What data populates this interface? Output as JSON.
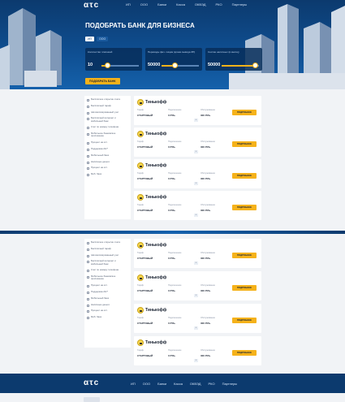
{
  "header": {
    "logo": "ατc",
    "nav": [
      "ИП",
      "ООО",
      "Банки",
      "Касса",
      "ОКВЭД",
      "РКО",
      "Партнеры"
    ]
  },
  "hero": {
    "title": "ПОДОБРАТЬ БАНК ДЛЯ БИЗНЕСА",
    "toggle": [
      "ИП",
      "ООО"
    ],
    "sliders": [
      {
        "label": "Количество платежей",
        "value": "10",
        "fraction": 0.15,
        "tip": "10"
      },
      {
        "label": "Переводы физ. лицам (кроме вывода ЗП)",
        "value": "50000",
        "fraction": 0.35,
        "tip": "50"
      },
      {
        "label": "Снятие наличных (в месяц)",
        "value": "50000",
        "fraction": 0.9,
        "tip": "50"
      }
    ],
    "button": "ПОДОБРАТЬ БАНК"
  },
  "filters": [
    "Бесплатное открытие счета",
    "Бесплатный тариф",
    "Автоматизированный учет",
    "Бесплатный интернет и мобильный банк",
    "Счет по номеру телефона",
    "Бесплатное обслуживание",
    "Процент на остаток",
    "Кэшбэк",
    "Выдача карт",
    "Процент на остаток",
    "Овердрафт",
    "Эквайринг",
    "Лимит снятия",
    "Бесплатное обслуживание"
  ],
  "filters_short": [
    "Бесплатное открытие счета",
    "Бесплатный тариф",
    "Автоматизированный учет",
    "Бесплатный интернет и мобильный банк",
    "Счет по номеру телефона",
    "Мобильное банковское приложение",
    "Процент на ост.",
    "Поддержка 24/7",
    "Мобильный банк",
    "Наличные деньги",
    "Процент на ост.",
    "Моб. банк"
  ],
  "card_labels": {
    "tariff": "Тариф",
    "payments": "Подключение",
    "service": "Обслуживание",
    "button": "ПОДРОБНЕЕ"
  },
  "cards": [
    {
      "bank": "Тинькофф",
      "tariff": "СТАРТОВЫЙ",
      "payments": "0 РУБ.",
      "service": "300 РУБ."
    },
    {
      "bank": "Тинькофф",
      "tariff": "СТАРТОВЫЙ",
      "payments": "0 РУБ.",
      "service": "300 РУБ."
    },
    {
      "bank": "Тинькофф",
      "tariff": "СТАРТОВЫЙ",
      "payments": "0 РУБ.",
      "service": "300 РУБ."
    },
    {
      "bank": "Тинькофф",
      "tariff": "СТАРТОВЫЙ",
      "payments": "0 РУБ.",
      "service": "300 РУБ."
    }
  ],
  "footer": {
    "logo": "ατc",
    "nav": [
      "ИП",
      "ООО",
      "Банки",
      "Касса",
      "ОКВЭД",
      "РКО",
      "Партнеры"
    ]
  },
  "colors": {
    "accent": "#f5b21a",
    "dark": "#0c3a6e"
  }
}
